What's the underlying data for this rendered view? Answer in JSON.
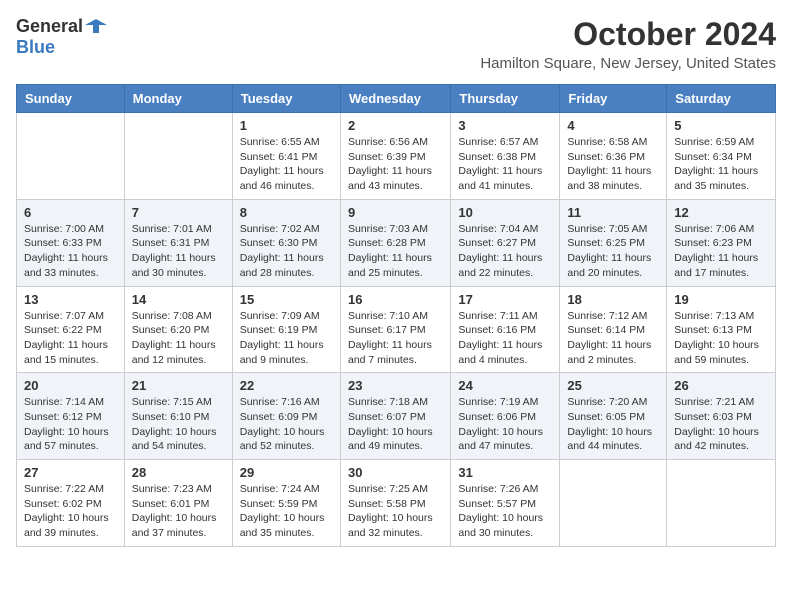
{
  "header": {
    "logo_general": "General",
    "logo_blue": "Blue",
    "title": "October 2024",
    "subtitle": "Hamilton Square, New Jersey, United States"
  },
  "days_of_week": [
    "Sunday",
    "Monday",
    "Tuesday",
    "Wednesday",
    "Thursday",
    "Friday",
    "Saturday"
  ],
  "weeks": [
    [
      {
        "day": "",
        "sunrise": "",
        "sunset": "",
        "daylight": ""
      },
      {
        "day": "",
        "sunrise": "",
        "sunset": "",
        "daylight": ""
      },
      {
        "day": "1",
        "sunrise": "Sunrise: 6:55 AM",
        "sunset": "Sunset: 6:41 PM",
        "daylight": "Daylight: 11 hours and 46 minutes."
      },
      {
        "day": "2",
        "sunrise": "Sunrise: 6:56 AM",
        "sunset": "Sunset: 6:39 PM",
        "daylight": "Daylight: 11 hours and 43 minutes."
      },
      {
        "day": "3",
        "sunrise": "Sunrise: 6:57 AM",
        "sunset": "Sunset: 6:38 PM",
        "daylight": "Daylight: 11 hours and 41 minutes."
      },
      {
        "day": "4",
        "sunrise": "Sunrise: 6:58 AM",
        "sunset": "Sunset: 6:36 PM",
        "daylight": "Daylight: 11 hours and 38 minutes."
      },
      {
        "day": "5",
        "sunrise": "Sunrise: 6:59 AM",
        "sunset": "Sunset: 6:34 PM",
        "daylight": "Daylight: 11 hours and 35 minutes."
      }
    ],
    [
      {
        "day": "6",
        "sunrise": "Sunrise: 7:00 AM",
        "sunset": "Sunset: 6:33 PM",
        "daylight": "Daylight: 11 hours and 33 minutes."
      },
      {
        "day": "7",
        "sunrise": "Sunrise: 7:01 AM",
        "sunset": "Sunset: 6:31 PM",
        "daylight": "Daylight: 11 hours and 30 minutes."
      },
      {
        "day": "8",
        "sunrise": "Sunrise: 7:02 AM",
        "sunset": "Sunset: 6:30 PM",
        "daylight": "Daylight: 11 hours and 28 minutes."
      },
      {
        "day": "9",
        "sunrise": "Sunrise: 7:03 AM",
        "sunset": "Sunset: 6:28 PM",
        "daylight": "Daylight: 11 hours and 25 minutes."
      },
      {
        "day": "10",
        "sunrise": "Sunrise: 7:04 AM",
        "sunset": "Sunset: 6:27 PM",
        "daylight": "Daylight: 11 hours and 22 minutes."
      },
      {
        "day": "11",
        "sunrise": "Sunrise: 7:05 AM",
        "sunset": "Sunset: 6:25 PM",
        "daylight": "Daylight: 11 hours and 20 minutes."
      },
      {
        "day": "12",
        "sunrise": "Sunrise: 7:06 AM",
        "sunset": "Sunset: 6:23 PM",
        "daylight": "Daylight: 11 hours and 17 minutes."
      }
    ],
    [
      {
        "day": "13",
        "sunrise": "Sunrise: 7:07 AM",
        "sunset": "Sunset: 6:22 PM",
        "daylight": "Daylight: 11 hours and 15 minutes."
      },
      {
        "day": "14",
        "sunrise": "Sunrise: 7:08 AM",
        "sunset": "Sunset: 6:20 PM",
        "daylight": "Daylight: 11 hours and 12 minutes."
      },
      {
        "day": "15",
        "sunrise": "Sunrise: 7:09 AM",
        "sunset": "Sunset: 6:19 PM",
        "daylight": "Daylight: 11 hours and 9 minutes."
      },
      {
        "day": "16",
        "sunrise": "Sunrise: 7:10 AM",
        "sunset": "Sunset: 6:17 PM",
        "daylight": "Daylight: 11 hours and 7 minutes."
      },
      {
        "day": "17",
        "sunrise": "Sunrise: 7:11 AM",
        "sunset": "Sunset: 6:16 PM",
        "daylight": "Daylight: 11 hours and 4 minutes."
      },
      {
        "day": "18",
        "sunrise": "Sunrise: 7:12 AM",
        "sunset": "Sunset: 6:14 PM",
        "daylight": "Daylight: 11 hours and 2 minutes."
      },
      {
        "day": "19",
        "sunrise": "Sunrise: 7:13 AM",
        "sunset": "Sunset: 6:13 PM",
        "daylight": "Daylight: 10 hours and 59 minutes."
      }
    ],
    [
      {
        "day": "20",
        "sunrise": "Sunrise: 7:14 AM",
        "sunset": "Sunset: 6:12 PM",
        "daylight": "Daylight: 10 hours and 57 minutes."
      },
      {
        "day": "21",
        "sunrise": "Sunrise: 7:15 AM",
        "sunset": "Sunset: 6:10 PM",
        "daylight": "Daylight: 10 hours and 54 minutes."
      },
      {
        "day": "22",
        "sunrise": "Sunrise: 7:16 AM",
        "sunset": "Sunset: 6:09 PM",
        "daylight": "Daylight: 10 hours and 52 minutes."
      },
      {
        "day": "23",
        "sunrise": "Sunrise: 7:18 AM",
        "sunset": "Sunset: 6:07 PM",
        "daylight": "Daylight: 10 hours and 49 minutes."
      },
      {
        "day": "24",
        "sunrise": "Sunrise: 7:19 AM",
        "sunset": "Sunset: 6:06 PM",
        "daylight": "Daylight: 10 hours and 47 minutes."
      },
      {
        "day": "25",
        "sunrise": "Sunrise: 7:20 AM",
        "sunset": "Sunset: 6:05 PM",
        "daylight": "Daylight: 10 hours and 44 minutes."
      },
      {
        "day": "26",
        "sunrise": "Sunrise: 7:21 AM",
        "sunset": "Sunset: 6:03 PM",
        "daylight": "Daylight: 10 hours and 42 minutes."
      }
    ],
    [
      {
        "day": "27",
        "sunrise": "Sunrise: 7:22 AM",
        "sunset": "Sunset: 6:02 PM",
        "daylight": "Daylight: 10 hours and 39 minutes."
      },
      {
        "day": "28",
        "sunrise": "Sunrise: 7:23 AM",
        "sunset": "Sunset: 6:01 PM",
        "daylight": "Daylight: 10 hours and 37 minutes."
      },
      {
        "day": "29",
        "sunrise": "Sunrise: 7:24 AM",
        "sunset": "Sunset: 5:59 PM",
        "daylight": "Daylight: 10 hours and 35 minutes."
      },
      {
        "day": "30",
        "sunrise": "Sunrise: 7:25 AM",
        "sunset": "Sunset: 5:58 PM",
        "daylight": "Daylight: 10 hours and 32 minutes."
      },
      {
        "day": "31",
        "sunrise": "Sunrise: 7:26 AM",
        "sunset": "Sunset: 5:57 PM",
        "daylight": "Daylight: 10 hours and 30 minutes."
      },
      {
        "day": "",
        "sunrise": "",
        "sunset": "",
        "daylight": ""
      },
      {
        "day": "",
        "sunrise": "",
        "sunset": "",
        "daylight": ""
      }
    ]
  ]
}
